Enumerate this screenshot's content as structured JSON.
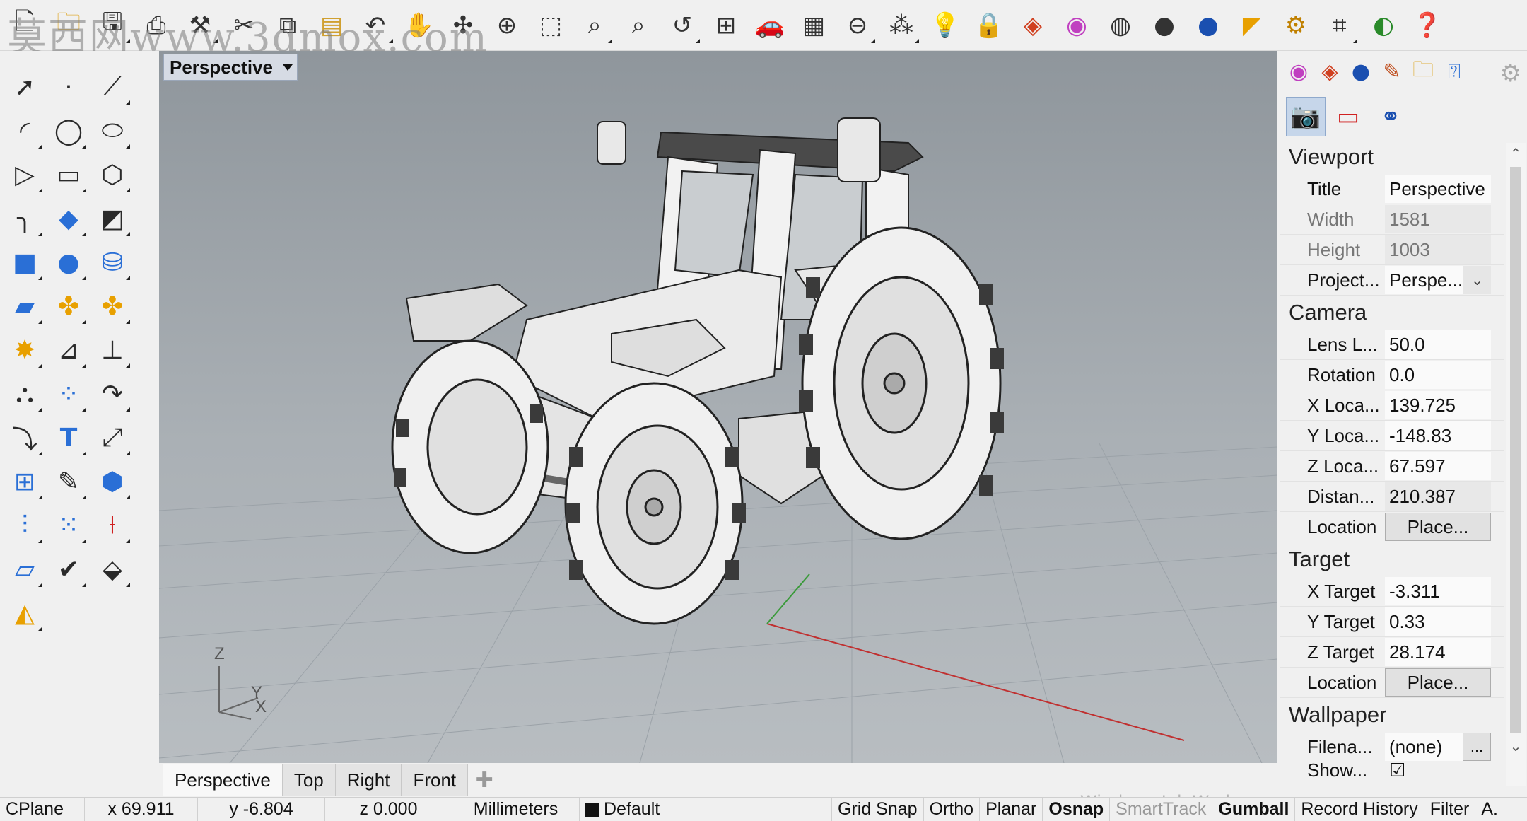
{
  "watermark": "莫西网www.3dmox.com",
  "viewport": {
    "title": "Perspective",
    "axis_z": "Z",
    "axis_y": "Y",
    "axis_x": "X"
  },
  "viewport_tabs": [
    "Perspective",
    "Top",
    "Right",
    "Front"
  ],
  "panel": {
    "sections": {
      "viewport": "Viewport",
      "camera": "Camera",
      "target": "Target",
      "wallpaper": "Wallpaper"
    },
    "viewport_props": [
      {
        "label": "Title",
        "value": "Perspective"
      },
      {
        "label": "Width",
        "value": "1581"
      },
      {
        "label": "Height",
        "value": "1003"
      },
      {
        "label": "Project...",
        "value": "Perspe..."
      }
    ],
    "camera_props": [
      {
        "label": "Lens L...",
        "value": "50.0"
      },
      {
        "label": "Rotation",
        "value": "0.0"
      },
      {
        "label": "X Loca...",
        "value": "139.725"
      },
      {
        "label": "Y Loca...",
        "value": "-148.83"
      },
      {
        "label": "Z Loca...",
        "value": "67.597"
      },
      {
        "label": "Distan...",
        "value": "210.387"
      },
      {
        "label": "Location",
        "value": "Place..."
      }
    ],
    "target_props": [
      {
        "label": "X Target",
        "value": "-3.311"
      },
      {
        "label": "Y Target",
        "value": "0.33"
      },
      {
        "label": "Z Target",
        "value": "28.174"
      },
      {
        "label": "Location",
        "value": "Place..."
      }
    ],
    "wallpaper_props": [
      {
        "label": "Filena...",
        "value": "(none)",
        "button": "..."
      },
      {
        "label": "Show...",
        "value": ""
      }
    ]
  },
  "statusbar": {
    "cplane": "CPlane",
    "x": "x 69.911",
    "y": "y -6.804",
    "z": "z 0.000",
    "units": "Millimeters",
    "layer": "Default",
    "grid_snap": "Grid Snap",
    "ortho": "Ortho",
    "planar": "Planar",
    "osnap": "Osnap",
    "smarttrack": "SmartTrack",
    "gumball": "Gumball",
    "record_history": "Record History",
    "filter": "Filter",
    "truncated": "A."
  },
  "overlay_text": "Windows Ink Workspace",
  "colors": {
    "viewport_bg_top": "#8f969c",
    "viewport_bg_bottom": "#b8bdc1",
    "x_axis": "#c03030",
    "active_tab": "#c6d6ea"
  },
  "icons": {
    "top_toolbar": [
      "new-file-icon",
      "open-folder-icon",
      "save-icon",
      "print-icon",
      "hammer-icon",
      "cut-icon",
      "copy-icon",
      "paste-icon",
      "undo-icon",
      "pan-hand-icon",
      "rotate-view-icon",
      "zoom-dynamic-icon",
      "zoom-window-icon",
      "zoom-extents-icon",
      "zoom-selected-icon",
      "undo-view-icon",
      "four-viewports-icon",
      "car-icon",
      "grid-plane-icon",
      "cplane-icon",
      "point-icon",
      "lightbulb-icon",
      "lock-icon",
      "layer-icon",
      "color-wheel-icon",
      "sphere-wire-icon",
      "sphere-shaded-icon",
      "sphere-blue-icon",
      "cone-icon",
      "settings-gear-icon",
      "dimension-icon",
      "globe-icon",
      "help-icon"
    ],
    "left_toolbar": [
      "select-arrow-icon",
      "point-icon",
      "polyline-icon",
      "arc-icon",
      "circle-icon",
      "ellipse-icon",
      "curve-icon",
      "rectangle-icon",
      "polygon-icon",
      "fillet-icon",
      "surface-patch-icon",
      "loft-icon",
      "box-icon",
      "boolean-union-icon",
      "cylinder-icon",
      "plane-surface-icon",
      "puzzle-icon",
      "puzzle-2-icon",
      "explode-icon",
      "trim-icon",
      "split-icon",
      "group-icon",
      "array-icon",
      "sweep-icon",
      "offset-icon",
      "text-icon",
      "scale-icon",
      "array-grid-icon",
      "edit-pen-icon",
      "solid-box-icon",
      "dimension-icon",
      "dots-grid-icon",
      "transform-icon",
      "extrude-icon",
      "check-icon",
      "solid-tools-icon",
      "render-icon"
    ]
  }
}
